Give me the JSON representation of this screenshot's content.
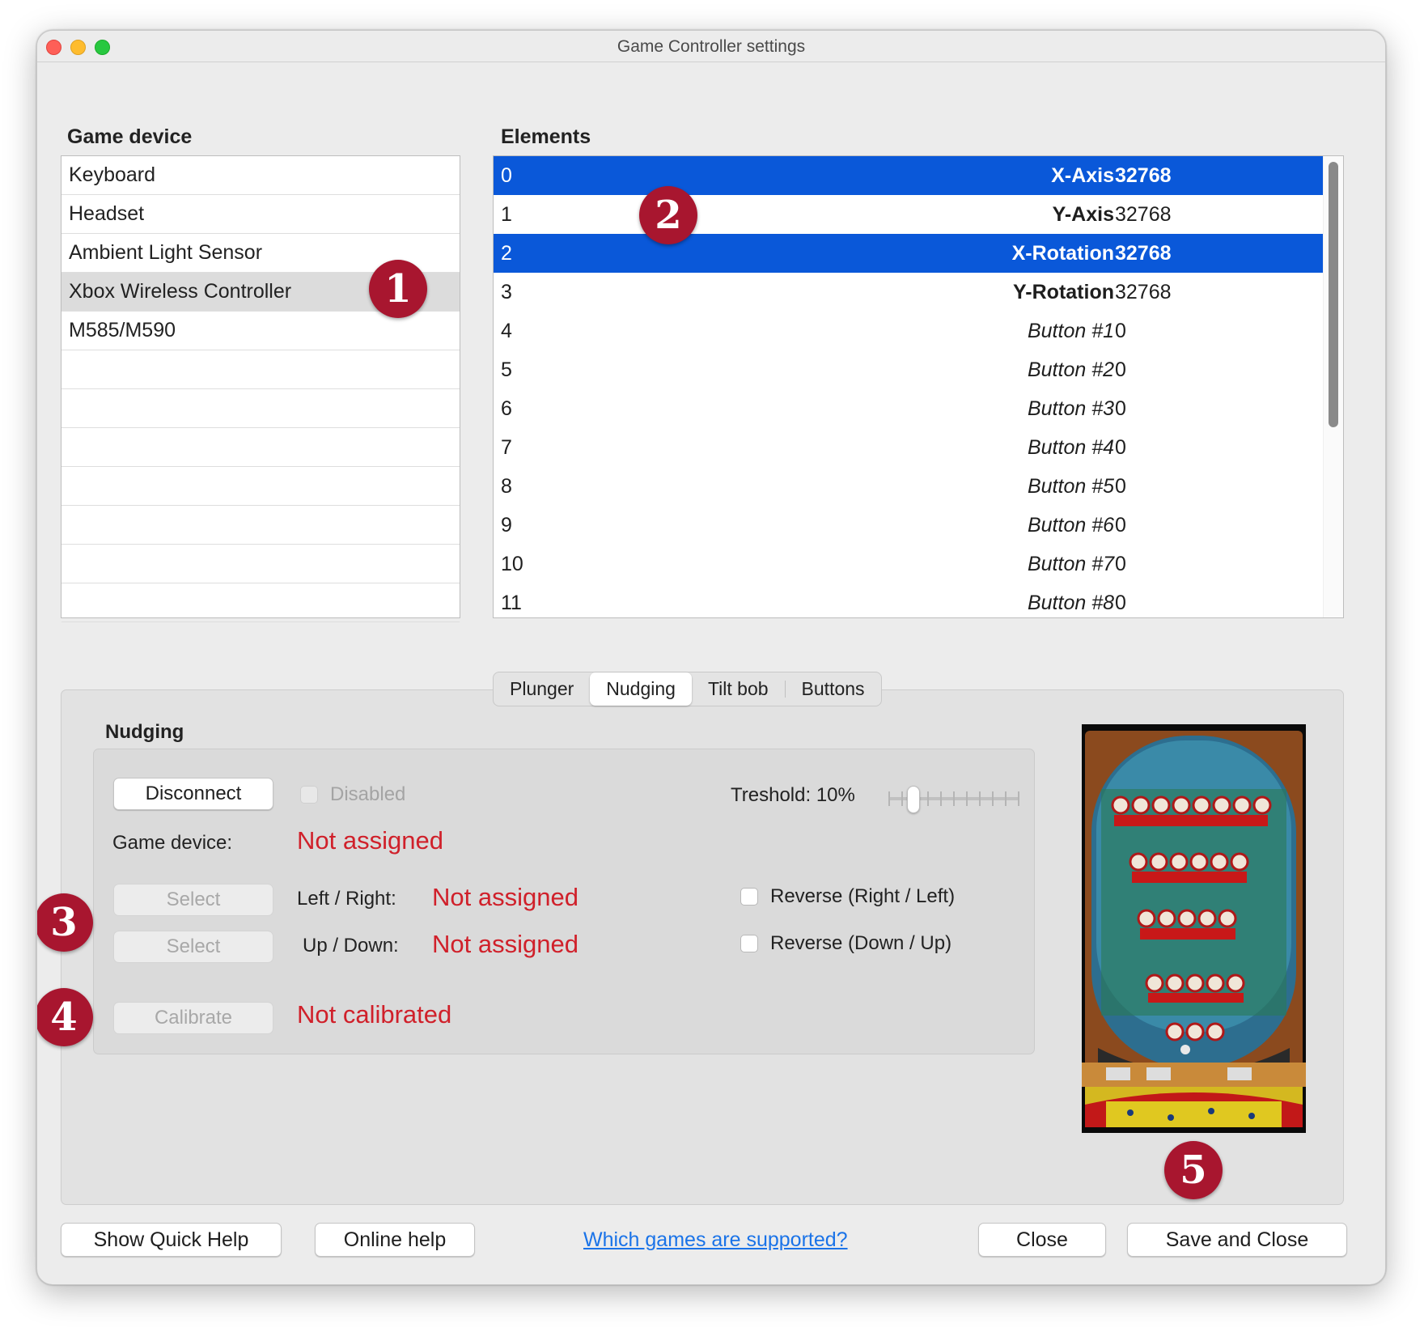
{
  "window": {
    "title": "Game Controller settings"
  },
  "game_device": {
    "label": "Game device",
    "items": [
      "Keyboard",
      "Headset",
      "Ambient Light Sensor",
      "Xbox Wireless Controller",
      "M585/M590",
      "",
      "",
      "",
      "",
      "",
      "",
      ""
    ],
    "selected_index": 3
  },
  "elements": {
    "label": "Elements",
    "rows": [
      {
        "index": "0",
        "name": "X-Axis",
        "value": "32768",
        "kind": "axis",
        "selected": true
      },
      {
        "index": "1",
        "name": "Y-Axis",
        "value": "32768",
        "kind": "axis",
        "selected": false
      },
      {
        "index": "2",
        "name": "X-Rotation",
        "value": "32768",
        "kind": "axis",
        "selected": true
      },
      {
        "index": "3",
        "name": "Y-Rotation",
        "value": "32768",
        "kind": "axis",
        "selected": false
      },
      {
        "index": "4",
        "name": "Button #1",
        "value": "0",
        "kind": "button",
        "selected": false
      },
      {
        "index": "5",
        "name": "Button #2",
        "value": "0",
        "kind": "button",
        "selected": false
      },
      {
        "index": "6",
        "name": "Button #3",
        "value": "0",
        "kind": "button",
        "selected": false
      },
      {
        "index": "7",
        "name": "Button #4",
        "value": "0",
        "kind": "button",
        "selected": false
      },
      {
        "index": "8",
        "name": "Button #5",
        "value": "0",
        "kind": "button",
        "selected": false
      },
      {
        "index": "9",
        "name": "Button #6",
        "value": "0",
        "kind": "button",
        "selected": false
      },
      {
        "index": "10",
        "name": "Button #7",
        "value": "0",
        "kind": "button",
        "selected": false
      },
      {
        "index": "11",
        "name": "Button #8",
        "value": "0",
        "kind": "button",
        "selected": false
      }
    ]
  },
  "tabs": {
    "items": [
      "Plunger",
      "Nudging",
      "Tilt bob",
      "Buttons"
    ],
    "active_index": 1
  },
  "nudging": {
    "title": "Nudging",
    "disconnect_label": "Disconnect",
    "disabled_label": "Disabled",
    "threshold_label": "Treshold: 10%",
    "threshold_value": 0.1,
    "game_device_label": "Game device:",
    "game_device_value": "Not assigned",
    "select_label": "Select",
    "left_right_label": "Left / Right:",
    "left_right_value": "Not assigned",
    "up_down_label": "Up / Down:",
    "up_down_value": "Not assigned",
    "reverse_lr_label": "Reverse (Right / Left)",
    "reverse_ud_label": "Reverse (Down / Up)",
    "calibrate_label": "Calibrate",
    "calibrate_status": "Not calibrated"
  },
  "footer": {
    "quick_help": "Show Quick Help",
    "online_help": "Online help",
    "link": "Which games are supported?",
    "close": "Close",
    "save_close": "Save and Close"
  },
  "markers": [
    "1",
    "2",
    "3",
    "4",
    "5"
  ],
  "colors": {
    "selection": "#0a58d9",
    "status_red": "#d0202a",
    "marker": "#a8162f",
    "link": "#1a73e8"
  }
}
